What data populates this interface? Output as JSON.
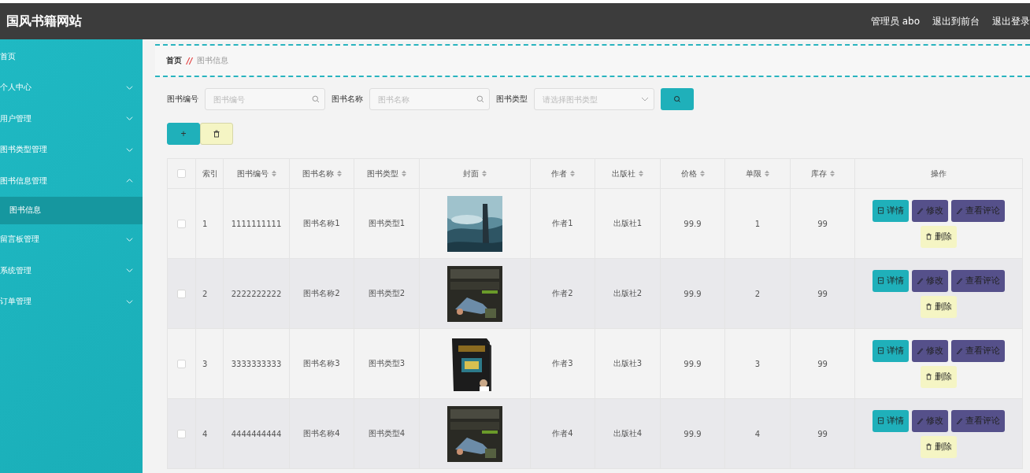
{
  "header": {
    "title": "国风书籍网站",
    "links": [
      "管理员 abo",
      "退出到前台",
      "退出登录"
    ]
  },
  "sidebar": {
    "items": [
      {
        "kind": "link",
        "label": "首页"
      },
      {
        "kind": "menu",
        "label": "个人中心",
        "expanded": false
      },
      {
        "kind": "menu",
        "label": "用户管理",
        "expanded": false
      },
      {
        "kind": "menu",
        "label": "图书类型管理",
        "expanded": false
      },
      {
        "kind": "menu",
        "label": "图书信息管理",
        "expanded": true,
        "children": [
          {
            "label": "图书信息",
            "selected": true
          }
        ]
      },
      {
        "kind": "menu",
        "label": "留言板管理",
        "expanded": false
      },
      {
        "kind": "menu",
        "label": "系统管理",
        "expanded": false
      },
      {
        "kind": "menu",
        "label": "订单管理",
        "expanded": false
      }
    ]
  },
  "breadcrumb": {
    "home": "首页",
    "separator": "//",
    "current": "图书信息"
  },
  "search": {
    "fields": [
      {
        "kind": "text",
        "label": "图书编号",
        "placeholder": "图书编号"
      },
      {
        "kind": "text",
        "label": "图书名称",
        "placeholder": "图书名称"
      },
      {
        "kind": "select",
        "label": "图书类型",
        "placeholder": "请选择图书类型"
      }
    ]
  },
  "toolbar": {
    "add": "+"
  },
  "table": {
    "select_all": {
      "checked": false
    },
    "columns": [
      {
        "kind": "text",
        "label": "索引",
        "sortable": false
      },
      {
        "kind": "text",
        "label": "图书编号",
        "sortable": true
      },
      {
        "kind": "text",
        "label": "图书名称",
        "sortable": true
      },
      {
        "kind": "text",
        "label": "图书类型",
        "sortable": true
      },
      {
        "kind": "cover",
        "label": "封面",
        "sortable": true
      },
      {
        "kind": "text",
        "label": "作者",
        "sortable": true
      },
      {
        "kind": "text",
        "label": "出版社",
        "sortable": true
      },
      {
        "kind": "text",
        "label": "价格",
        "sortable": true
      },
      {
        "kind": "text",
        "label": "单限",
        "sortable": true
      },
      {
        "kind": "text",
        "label": "库存",
        "sortable": true
      },
      {
        "kind": "actions",
        "label": "操作",
        "sortable": false
      }
    ],
    "rows": [
      {
        "checked": false,
        "cells": [
          "1",
          "1111111111",
          "图书名称1",
          "图书类型1",
          {
            "kind": "picture"
          },
          "作者1",
          "出版社1",
          "99.9",
          "1",
          "99",
          [
            {
              "kind": "detail",
              "label": "详情"
            },
            {
              "kind": "edit",
              "label": "修改"
            },
            {
              "kind": "edit",
              "label": "查看评论"
            },
            {
              "kind": "delete",
              "label": "删除"
            }
          ]
        ]
      },
      {
        "checked": false,
        "cells": [
          "2",
          "2222222222",
          "图书名称2",
          "图书类型2",
          {
            "kind": "picture"
          },
          "作者2",
          "出版社2",
          "99.9",
          "2",
          "99",
          [
            {
              "kind": "detail",
              "label": "详情"
            },
            {
              "kind": "edit",
              "label": "修改"
            },
            {
              "kind": "edit",
              "label": "查看评论"
            },
            {
              "kind": "delete",
              "label": "删除"
            }
          ]
        ]
      },
      {
        "checked": false,
        "cells": [
          "3",
          "3333333333",
          "图书名称3",
          "图书类型3",
          {
            "kind": "picture"
          },
          "作者3",
          "出版社3",
          "99.9",
          "3",
          "99",
          [
            {
              "kind": "detail",
              "label": "详情"
            },
            {
              "kind": "edit",
              "label": "修改"
            },
            {
              "kind": "edit",
              "label": "查看评论"
            },
            {
              "kind": "delete",
              "label": "删除"
            }
          ]
        ]
      },
      {
        "checked": false,
        "cells": [
          "4",
          "4444444444",
          "图书名称4",
          "图书类型4",
          {
            "kind": "picture"
          },
          "作者4",
          "出版社4",
          "99.9",
          "4",
          "99",
          [
            {
              "kind": "detail",
              "label": "详情"
            },
            {
              "kind": "edit",
              "label": "修改"
            },
            {
              "kind": "edit",
              "label": "查看评论"
            },
            {
              "kind": "delete",
              "label": "删除"
            }
          ]
        ]
      }
    ]
  }
}
